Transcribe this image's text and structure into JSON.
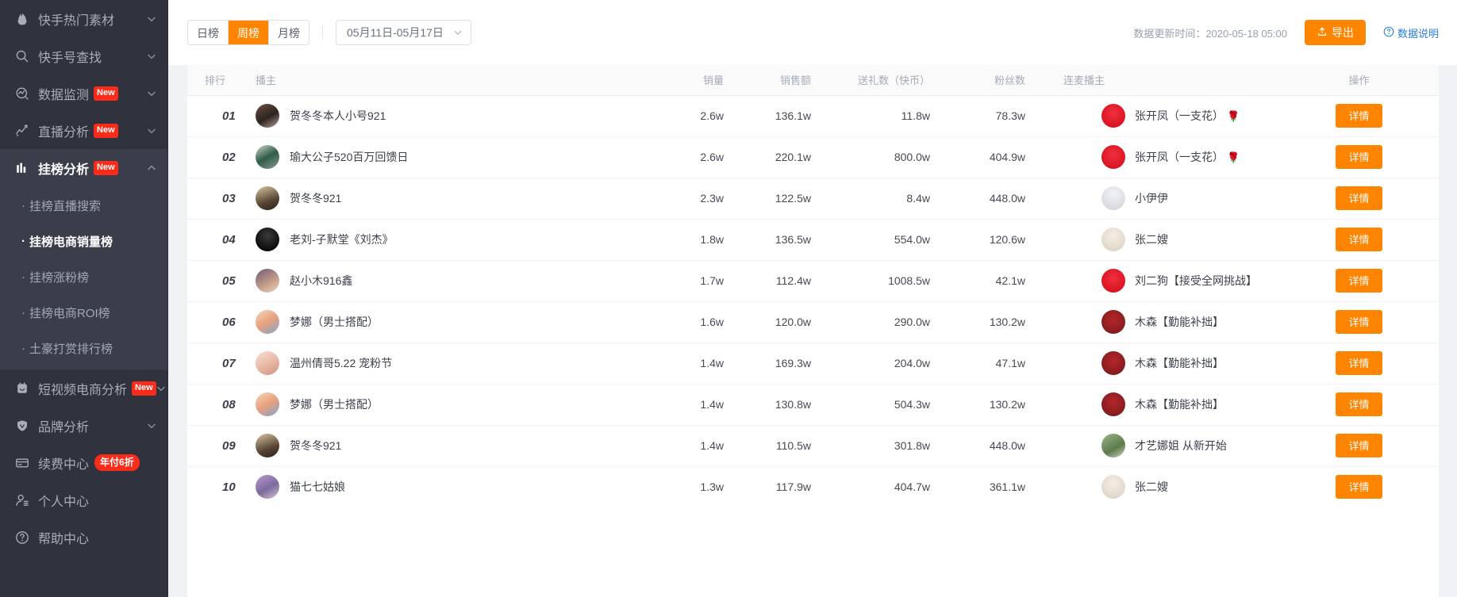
{
  "sidebar": {
    "items": [
      {
        "label": "快手热门素材",
        "icon": "flame-icon",
        "chevron": "down",
        "badge": ""
      },
      {
        "label": "快手号查找",
        "icon": "search-icon",
        "chevron": "down",
        "badge": ""
      },
      {
        "label": "数据监测",
        "icon": "monitor-icon",
        "chevron": "down",
        "badge": "New"
      },
      {
        "label": "直播分析",
        "icon": "trend-icon",
        "chevron": "down",
        "badge": "New"
      },
      {
        "label": "挂榜分析",
        "icon": "bar-chart-icon",
        "chevron": "up",
        "badge": "New",
        "active": true
      }
    ],
    "subitems": [
      {
        "label": "挂榜直播搜索"
      },
      {
        "label": "挂榜电商销量榜",
        "active": true
      },
      {
        "label": "挂榜涨粉榜"
      },
      {
        "label": "挂榜电商ROI榜"
      },
      {
        "label": "土豪打赏排行榜"
      }
    ],
    "items_bottom": [
      {
        "label": "短视频电商分析",
        "icon": "shortvideo-icon",
        "chevron": "down",
        "badge": "New"
      },
      {
        "label": "品牌分析",
        "icon": "shield-icon",
        "chevron": "down",
        "badge": ""
      },
      {
        "label": "续费中心",
        "icon": "card-icon",
        "chevron": "",
        "badge_discount": "年付6折"
      },
      {
        "label": "个人中心",
        "icon": "user-icon",
        "chevron": "",
        "badge": ""
      },
      {
        "label": "帮助中心",
        "icon": "question-icon",
        "chevron": "",
        "badge": ""
      }
    ]
  },
  "toolbar": {
    "tabs": [
      {
        "label": "日榜",
        "selected": false
      },
      {
        "label": "周榜",
        "selected": true
      },
      {
        "label": "月榜",
        "selected": false
      }
    ],
    "date_range": "05月11日-05月17日",
    "update_time_label": "数据更新时间：2020-05-18 05:00",
    "export_label": "导出",
    "export_icon": "upload-icon",
    "data_note_label": "数据说明",
    "data_note_icon": "question-circle-icon",
    "accent_color": "#ff8500",
    "link_color": "#2a7fe0"
  },
  "table": {
    "columns": [
      "排行",
      "播主",
      "销量",
      "销售额",
      "送礼数（快币）",
      "粉丝数",
      "连麦播主",
      "操作"
    ],
    "action_label": "详情",
    "rows": [
      {
        "rank": "01",
        "host": "贺冬冬本人小号921",
        "sales": "2.6w",
        "amount": "136.1w",
        "gifts": "11.8w",
        "fans": "78.3w",
        "co_host": "张开凤（一支花）",
        "co_rose": "🌹",
        "avatar": "g1",
        "co_avatar": "ca-red"
      },
      {
        "rank": "02",
        "host": "瑜大公子520百万回馈日",
        "sales": "2.6w",
        "amount": "220.1w",
        "gifts": "800.0w",
        "fans": "404.9w",
        "co_host": "张开凤（一支花）",
        "co_rose": "🌹",
        "avatar": "g2",
        "co_avatar": "ca-red"
      },
      {
        "rank": "03",
        "host": "贺冬冬921",
        "sales": "2.3w",
        "amount": "122.5w",
        "gifts": "8.4w",
        "fans": "448.0w",
        "co_host": "小伊伊",
        "co_rose": "",
        "avatar": "g3",
        "co_avatar": "ca-white"
      },
      {
        "rank": "04",
        "host": "老刘-子默堂《刘杰》",
        "sales": "1.8w",
        "amount": "136.5w",
        "gifts": "554.0w",
        "fans": "120.6w",
        "co_host": "张二嫂",
        "co_rose": "",
        "avatar": "g4",
        "co_avatar": "ca-cream"
      },
      {
        "rank": "05",
        "host": "赵小木916鑫",
        "sales": "1.7w",
        "amount": "112.4w",
        "gifts": "1008.5w",
        "fans": "42.1w",
        "co_host": "刘二狗【接受全网挑战】",
        "co_rose": "",
        "avatar": "g5",
        "co_avatar": "ca-red"
      },
      {
        "rank": "06",
        "host": "梦娜（男士搭配）",
        "sales": "1.6w",
        "amount": "120.0w",
        "gifts": "290.0w",
        "fans": "130.2w",
        "co_host": "木森【勤能补拙】",
        "co_rose": "",
        "avatar": "g6",
        "co_avatar": "ca-dark"
      },
      {
        "rank": "07",
        "host": "温州倩哥5.22 宠粉节",
        "sales": "1.4w",
        "amount": "169.3w",
        "gifts": "204.0w",
        "fans": "47.1w",
        "co_host": "木森【勤能补拙】",
        "co_rose": "",
        "avatar": "g7",
        "co_avatar": "ca-dark"
      },
      {
        "rank": "08",
        "host": "梦娜（男士搭配）",
        "sales": "1.4w",
        "amount": "130.8w",
        "gifts": "504.3w",
        "fans": "130.2w",
        "co_host": "木森【勤能补拙】",
        "co_rose": "",
        "avatar": "g6",
        "co_avatar": "ca-dark"
      },
      {
        "rank": "09",
        "host": "贺冬冬921",
        "sales": "1.4w",
        "amount": "110.5w",
        "gifts": "301.8w",
        "fans": "448.0w",
        "co_host": "才艺娜姐 从新开始",
        "co_rose": "",
        "avatar": "g3",
        "co_avatar": "ca-green"
      },
      {
        "rank": "10",
        "host": "猫七七姑娘",
        "sales": "1.3w",
        "amount": "117.9w",
        "gifts": "404.7w",
        "fans": "361.1w",
        "co_host": "张二嫂",
        "co_rose": "",
        "avatar": "g8",
        "co_avatar": "ca-cream"
      }
    ]
  }
}
